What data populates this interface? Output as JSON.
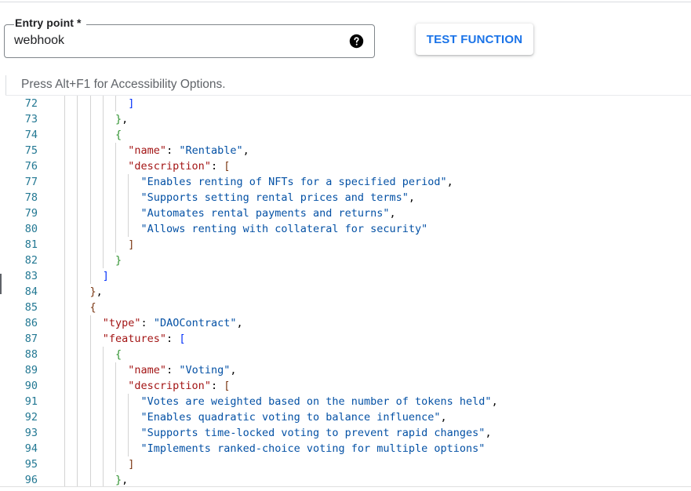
{
  "entry_point": {
    "label": "Entry point *",
    "value": "webhook",
    "help_icon": "help-circle-icon"
  },
  "test_button": {
    "label": "TEST FUNCTION"
  },
  "editor": {
    "accessibility_hint": "Press Alt+F1 for Accessibility Options.",
    "lines": [
      {
        "n": "72",
        "indent": 10,
        "tokens": [
          {
            "t": "]",
            "c": "b1"
          }
        ]
      },
      {
        "n": "73",
        "indent": 8,
        "tokens": [
          {
            "t": "}",
            "c": "b2"
          },
          {
            "t": ",",
            "c": "p"
          }
        ]
      },
      {
        "n": "74",
        "indent": 8,
        "tokens": [
          {
            "t": "{",
            "c": "b2"
          }
        ]
      },
      {
        "n": "75",
        "indent": 10,
        "tokens": [
          {
            "t": "\"name\"",
            "c": "k"
          },
          {
            "t": ": ",
            "c": "p"
          },
          {
            "t": "\"Rentable\"",
            "c": "s"
          },
          {
            "t": ",",
            "c": "p"
          }
        ]
      },
      {
        "n": "76",
        "indent": 10,
        "tokens": [
          {
            "t": "\"description\"",
            "c": "k"
          },
          {
            "t": ": ",
            "c": "p"
          },
          {
            "t": "[",
            "c": "b3"
          }
        ]
      },
      {
        "n": "77",
        "indent": 12,
        "tokens": [
          {
            "t": "\"Enables renting of NFTs for a specified period\"",
            "c": "s"
          },
          {
            "t": ",",
            "c": "p"
          }
        ]
      },
      {
        "n": "78",
        "indent": 12,
        "tokens": [
          {
            "t": "\"Supports setting rental prices and terms\"",
            "c": "s"
          },
          {
            "t": ",",
            "c": "p"
          }
        ]
      },
      {
        "n": "79",
        "indent": 12,
        "tokens": [
          {
            "t": "\"Automates rental payments and returns\"",
            "c": "s"
          },
          {
            "t": ",",
            "c": "p"
          }
        ]
      },
      {
        "n": "80",
        "indent": 12,
        "tokens": [
          {
            "t": "\"Allows renting with collateral for security\"",
            "c": "s"
          }
        ]
      },
      {
        "n": "81",
        "indent": 10,
        "tokens": [
          {
            "t": "]",
            "c": "b3"
          }
        ]
      },
      {
        "n": "82",
        "indent": 8,
        "tokens": [
          {
            "t": "}",
            "c": "b2"
          }
        ]
      },
      {
        "n": "83",
        "indent": 6,
        "tokens": [
          {
            "t": "]",
            "c": "b1"
          }
        ]
      },
      {
        "n": "84",
        "indent": 4,
        "tokens": [
          {
            "t": "}",
            "c": "b3"
          },
          {
            "t": ",",
            "c": "p"
          }
        ]
      },
      {
        "n": "85",
        "indent": 4,
        "tokens": [
          {
            "t": "{",
            "c": "b3"
          }
        ]
      },
      {
        "n": "86",
        "indent": 6,
        "tokens": [
          {
            "t": "\"type\"",
            "c": "k"
          },
          {
            "t": ": ",
            "c": "p"
          },
          {
            "t": "\"DAOContract\"",
            "c": "s"
          },
          {
            "t": ",",
            "c": "p"
          }
        ]
      },
      {
        "n": "87",
        "indent": 6,
        "tokens": [
          {
            "t": "\"features\"",
            "c": "k"
          },
          {
            "t": ": ",
            "c": "p"
          },
          {
            "t": "[",
            "c": "b1"
          }
        ]
      },
      {
        "n": "88",
        "indent": 8,
        "tokens": [
          {
            "t": "{",
            "c": "b2"
          }
        ]
      },
      {
        "n": "89",
        "indent": 10,
        "tokens": [
          {
            "t": "\"name\"",
            "c": "k"
          },
          {
            "t": ": ",
            "c": "p"
          },
          {
            "t": "\"Voting\"",
            "c": "s"
          },
          {
            "t": ",",
            "c": "p"
          }
        ]
      },
      {
        "n": "90",
        "indent": 10,
        "tokens": [
          {
            "t": "\"description\"",
            "c": "k"
          },
          {
            "t": ": ",
            "c": "p"
          },
          {
            "t": "[",
            "c": "b3"
          }
        ]
      },
      {
        "n": "91",
        "indent": 12,
        "tokens": [
          {
            "t": "\"Votes are weighted based on the number of tokens held\"",
            "c": "s"
          },
          {
            "t": ",",
            "c": "p"
          }
        ]
      },
      {
        "n": "92",
        "indent": 12,
        "tokens": [
          {
            "t": "\"Enables quadratic voting to balance influence\"",
            "c": "s"
          },
          {
            "t": ",",
            "c": "p"
          }
        ]
      },
      {
        "n": "93",
        "indent": 12,
        "tokens": [
          {
            "t": "\"Supports time-locked voting to prevent rapid changes\"",
            "c": "s"
          },
          {
            "t": ",",
            "c": "p"
          }
        ]
      },
      {
        "n": "94",
        "indent": 12,
        "tokens": [
          {
            "t": "\"Implements ranked-choice voting for multiple options\"",
            "c": "s"
          }
        ]
      },
      {
        "n": "95",
        "indent": 10,
        "tokens": [
          {
            "t": "]",
            "c": "b3"
          }
        ]
      },
      {
        "n": "96",
        "indent": 8,
        "tokens": [
          {
            "t": "}",
            "c": "b2"
          },
          {
            "t": ",",
            "c": "p"
          }
        ]
      }
    ]
  }
}
